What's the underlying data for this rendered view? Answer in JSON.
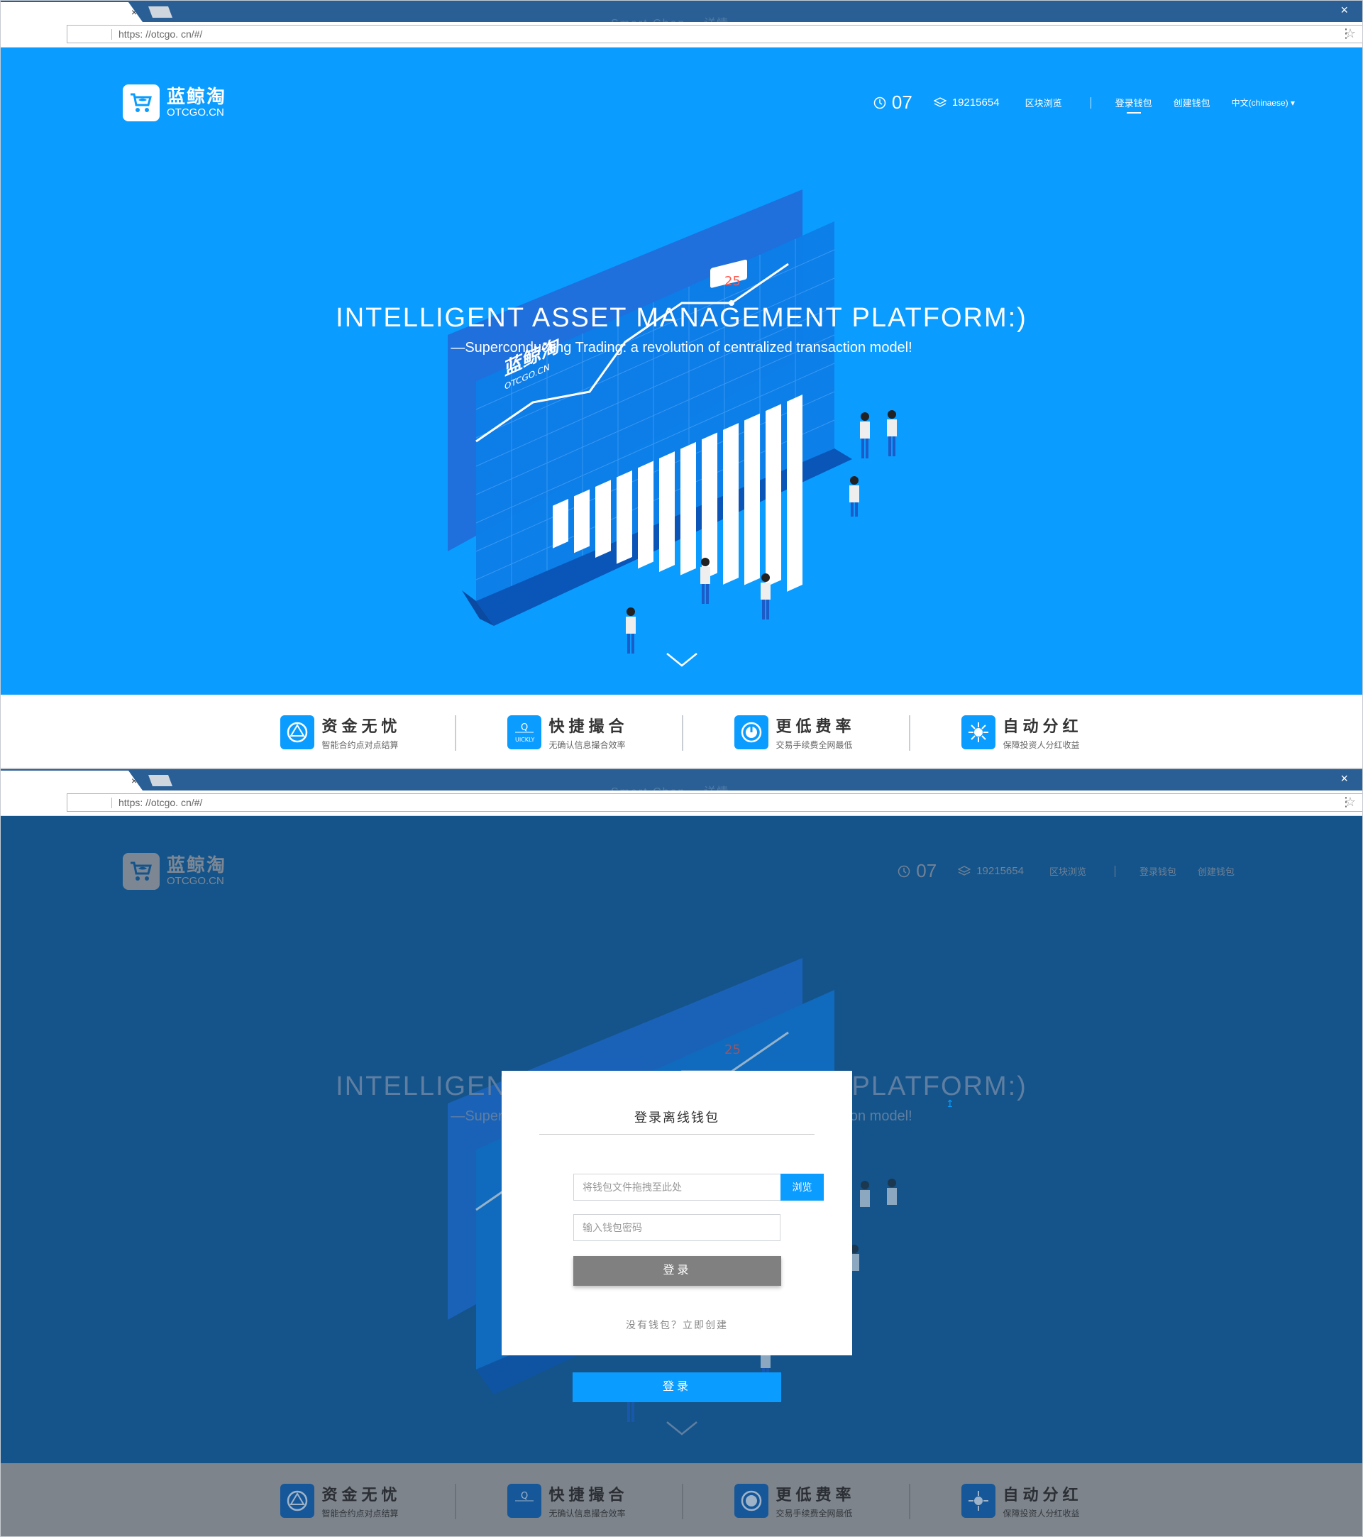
{
  "browser": {
    "url": "https: //otcgo. cn/#/",
    "tab_close": "×",
    "window_close": "×",
    "faded_title": "Smart Chan... 详情"
  },
  "brand": {
    "name_cn": "蓝鲸淘",
    "name_en": "OTCGO.CN",
    "color": "#0a9cff"
  },
  "nav": {
    "block_time": "07",
    "block_height": "19215654",
    "explorer": "区块浏览",
    "login_wallet": "登录钱包",
    "create_wallet": "创建钱包",
    "language": "中文(chinaese)"
  },
  "hero": {
    "title": "INTELLIGENT ASSET MANAGEMENT PLATFORM:)",
    "subtitle": "—Superconducting Trading: a revolution of centralized transaction model!",
    "chart_tag_value": "25",
    "chart_logo_cn": "蓝鲸淘",
    "chart_logo_en": "OTCGO.CN"
  },
  "features": [
    {
      "title": "资金无忧",
      "desc": "智能合约点对点结算",
      "icon": "shield-cycle-icon"
    },
    {
      "title": "快捷撮合",
      "desc": "无确认信息撮合效率",
      "icon": "quick-match-icon"
    },
    {
      "title": "更低费率",
      "desc": "交易手续费全网最低",
      "icon": "clock-gauge-icon"
    },
    {
      "title": "自动分红",
      "desc": "保障投资人分红收益",
      "icon": "network-hub-icon"
    }
  ],
  "modal": {
    "title": "登录离线钱包",
    "file_placeholder": "将钱包文件拖拽至此处",
    "browse_label": "浏览",
    "password_placeholder": "输入钱包密码",
    "login_label": "登录",
    "create_link": "没有钱包？立即创建"
  },
  "page_login_button": "登录",
  "upload_arrow": "↥"
}
